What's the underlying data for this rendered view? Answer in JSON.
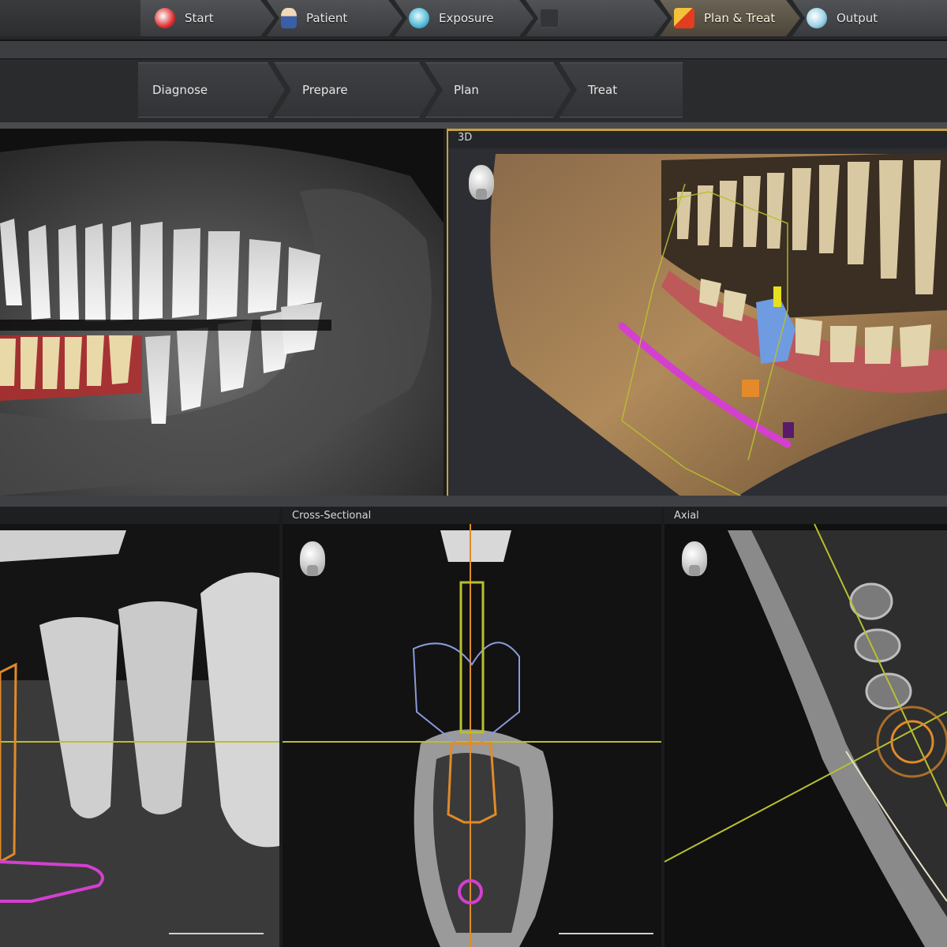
{
  "workflow": {
    "steps": [
      {
        "label": "Start",
        "icon": "home-icon",
        "state": "normal"
      },
      {
        "label": "Patient",
        "icon": "patient-icon",
        "state": "normal"
      },
      {
        "label": "Exposure",
        "icon": "exposure-icon",
        "state": "normal"
      },
      {
        "label": "",
        "icon": "disabled-step-icon",
        "state": "disabled"
      },
      {
        "label": "Plan & Treat",
        "icon": "plan-treat-icon",
        "state": "active"
      },
      {
        "label": "Output",
        "icon": "output-icon",
        "state": "normal"
      }
    ]
  },
  "subworkflow": {
    "steps": [
      "Diagnose",
      "Prepare",
      "Plan",
      "Treat"
    ]
  },
  "views": {
    "view_3d": {
      "label": "3D"
    },
    "cross_sectional": {
      "label": "Cross-Sectional"
    },
    "axial": {
      "label": "Axial"
    }
  },
  "colors": {
    "active_accent": "#c8a040",
    "implant_outline": "#e08a2a",
    "nerve_canal": "#d43fd0",
    "guide_line": "#b8c030"
  }
}
